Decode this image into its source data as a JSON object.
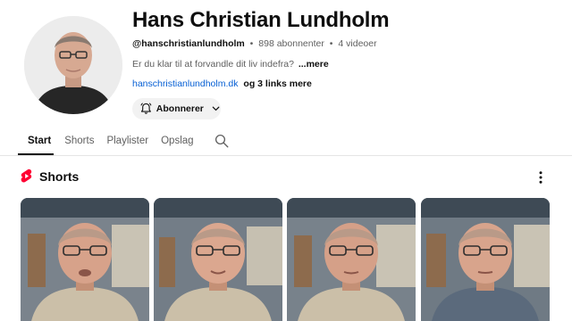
{
  "channel": {
    "name": "Hans Christian Lundholm",
    "handle": "@hanschristianlundholm",
    "separator": "•",
    "subscribers": "898 abonnenter",
    "videos": "4 videoer",
    "description": "Er du klar til at forvandle dit liv indefra?",
    "description_more": "...mere",
    "link_text": "hanschristianlundholm.dk",
    "more_links": "og 3 links mere"
  },
  "subscribe": {
    "label": "Abonnerer",
    "icon": "bell-icon",
    "chevron": "chevron-down-icon"
  },
  "tabs": [
    {
      "label": "Start",
      "active": true
    },
    {
      "label": "Shorts",
      "active": false
    },
    {
      "label": "Playlister",
      "active": false
    },
    {
      "label": "Opslag",
      "active": false
    }
  ],
  "shorts_section": {
    "title": "Shorts",
    "icon": "shorts-logo-icon",
    "menu_icon": "more-vert-icon"
  },
  "shorts": [
    {
      "shirt": "#cbbfa8"
    },
    {
      "shirt": "#cbbfa8"
    },
    {
      "shirt": "#cbbfa8"
    },
    {
      "shirt": "#5b6a7c"
    }
  ],
  "colors": {
    "accent_red": "#ff0033",
    "link_blue": "#065fd4",
    "text": "#0f0f0f",
    "muted": "#606060"
  }
}
